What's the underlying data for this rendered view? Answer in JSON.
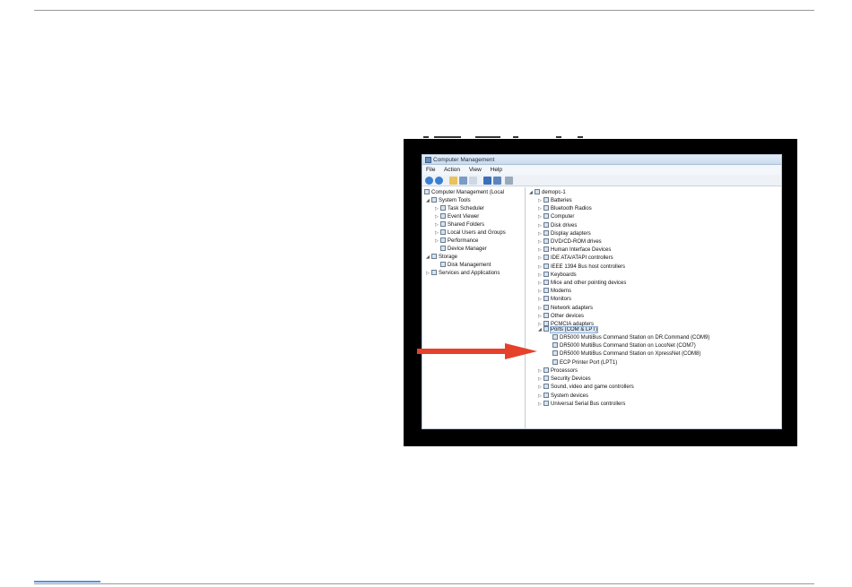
{
  "window": {
    "title": "Computer Management",
    "menu": [
      "File",
      "Action",
      "View",
      "Help"
    ]
  },
  "left_tree": {
    "root": "Computer Management (Local",
    "system_tools": "System Tools",
    "task_scheduler": "Task Scheduler",
    "event_viewer": "Event Viewer",
    "shared_folders": "Shared Folders",
    "local_users": "Local Users and Groups",
    "performance": "Performance",
    "device_manager": "Device Manager",
    "storage": "Storage",
    "disk_management": "Disk Management",
    "services": "Services and Applications"
  },
  "device_tree": {
    "root": "demopc-1",
    "categories": [
      "Batteries",
      "Bluetooth Radios",
      "Computer",
      "Disk drives",
      "Display adapters",
      "DVD/CD-ROM drives",
      "Human Interface Devices",
      "IDE ATA/ATAPI controllers",
      "IEEE 1394 Bus host controllers",
      "Keyboards",
      "Mice and other pointing devices",
      "Modems",
      "Monitors",
      "Network adapters",
      "Other devices",
      "PCMCIA adapters"
    ],
    "ports": "Ports (COM & LPT)",
    "port_items": [
      "DR5000 MultiBus Command Station on DR.Command (COM9)",
      "DR5000 MultiBus Command Station on LocoNet (COM7)",
      "DR5000 MultiBus Command Station on XpressNet (COM8)",
      "ECP Printer Port (LPT1)"
    ],
    "after_ports": [
      "Processors",
      "Security Devices",
      "Sound, video and game controllers",
      "System devices",
      "Universal Serial Bus controllers"
    ]
  },
  "colors": {
    "arrow": "#e5412b",
    "frame": "#000000",
    "accent_rule": "#5b8fd4"
  }
}
